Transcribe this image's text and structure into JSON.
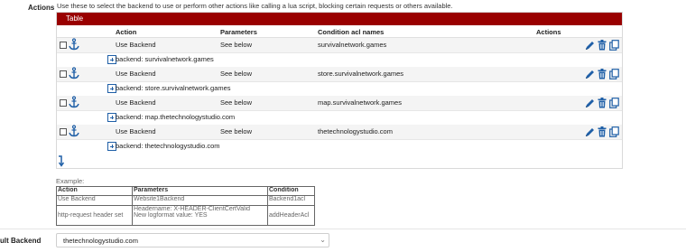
{
  "section": {
    "label": "Actions",
    "help": "Use these to select the backend to use or perform other actions like calling a lua script, blocking certain requests or others available."
  },
  "table": {
    "title": "Table",
    "columns": {
      "action": "Action",
      "parameters": "Parameters",
      "condition": "Condition acl names",
      "actions": "Actions"
    },
    "rows": [
      {
        "action": "Use Backend",
        "parameters": "See below",
        "condition": "survivalnetwork.games",
        "sub": "backend: survivalnetwork.games"
      },
      {
        "action": "Use Backend",
        "parameters": "See below",
        "condition": "store.survivalnetwork.games",
        "sub": "backend: store.survivalnetwork.games"
      },
      {
        "action": "Use Backend",
        "parameters": "See below",
        "condition": "map.survivalnetwork.games",
        "sub": "backend: map.thetechnologystudio.com"
      },
      {
        "action": "Use Backend",
        "parameters": "See below",
        "condition": "thetechnologystudio.com",
        "sub": "backend: thetechnologystudio.com"
      }
    ]
  },
  "example": {
    "label": "Example:",
    "headers": [
      "Action",
      "Parameters",
      "Condition"
    ],
    "rows": [
      [
        "Use Backend",
        "Website1Backend",
        "Backend1acl"
      ],
      [
        "http-request header set",
        "Headername: X-HEADER-ClientCertValid",
        "addHeaderAcl"
      ]
    ],
    "row2_param_line2": "New logformat value: YES"
  },
  "default_backend": {
    "label": "ult Backend",
    "value": "thetechnologystudio.com"
  },
  "colors": {
    "header_bar": "#990000",
    "icon_blue": "#1f5fa7"
  },
  "icons": [
    "anchor-icon",
    "pencil-icon",
    "trash-icon",
    "copy-icon",
    "plus-box-icon",
    "arrow-down-icon"
  ]
}
